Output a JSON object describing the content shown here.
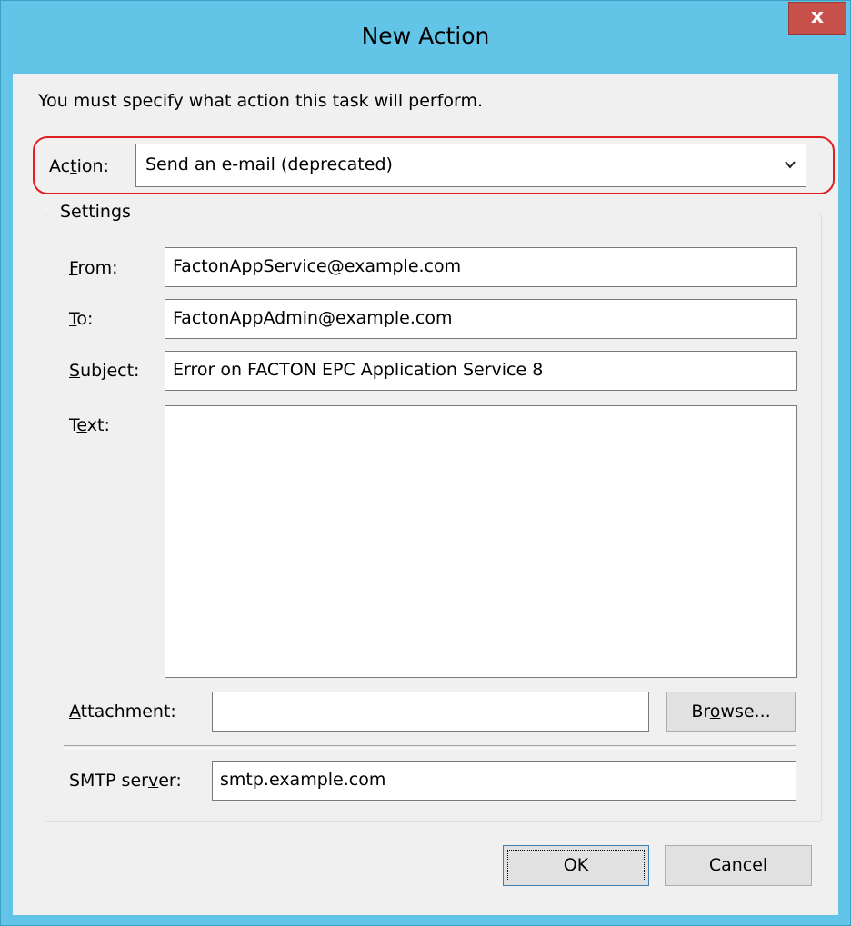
{
  "window": {
    "title": "New Action",
    "close_glyph": "x"
  },
  "instruction": "You must specify what action this task will perform.",
  "action": {
    "label_pre": "Ac",
    "label_ul": "t",
    "label_post": "ion:",
    "value": "Send an e-mail (deprecated)",
    "chevron_icon": "chevron-down-icon"
  },
  "settings": {
    "title": "Settings",
    "from": {
      "label_ul": "F",
      "label_post": "rom:",
      "value": "FactonAppService@example.com"
    },
    "to": {
      "label_ul": "T",
      "label_post": "o:",
      "value": "FactonAppAdmin@example.com"
    },
    "subject": {
      "label_ul": "S",
      "label_post": "ubject:",
      "value": "Error on FACTON EPC Application Service 8"
    },
    "text": {
      "label_pre": "T",
      "label_ul": "e",
      "label_post": "xt:",
      "value": ""
    },
    "attachment": {
      "label_ul": "A",
      "label_post": "ttachment:",
      "value": ""
    },
    "browse": {
      "label_pre": "Br",
      "label_ul": "o",
      "label_post": "wse..."
    },
    "smtp": {
      "label_pre": "SMTP ser",
      "label_ul": "v",
      "label_post": "er:",
      "value": "smtp.example.com"
    }
  },
  "buttons": {
    "ok": "OK",
    "cancel": "Cancel"
  },
  "colors": {
    "titlebar": "#62c4e7",
    "close": "#c7504a",
    "highlight": "#e02020",
    "client": "#f0f0f0"
  }
}
